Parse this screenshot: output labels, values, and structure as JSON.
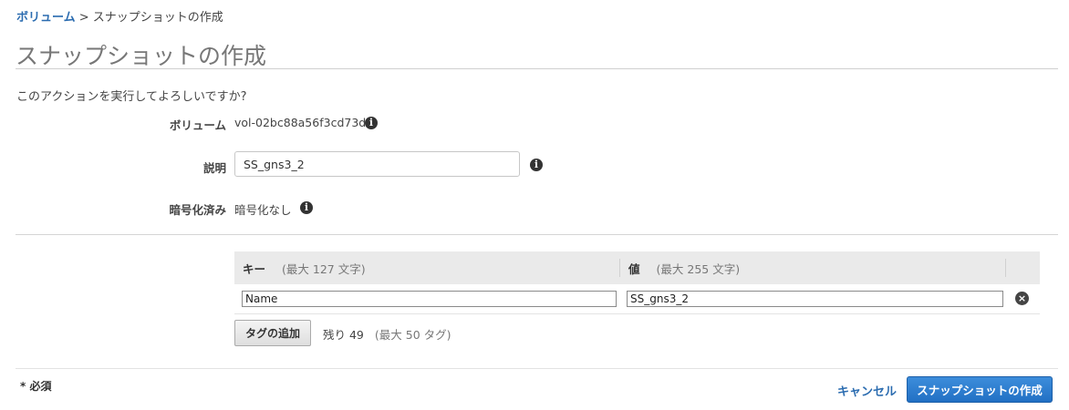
{
  "breadcrumb": {
    "link": "ボリューム",
    "separator": " > ",
    "current": "スナップショットの作成"
  },
  "page_title": "スナップショットの作成",
  "confirm_text": "このアクションを実行してよろしいですか?",
  "fields": {
    "volume": {
      "label": "ボリューム",
      "value": "vol-02bc88a56f3cd73d6",
      "icon": "info-icon"
    },
    "description": {
      "label": "説明",
      "value": "SS_gns3_2",
      "icon": "info-icon"
    },
    "encryption": {
      "label": "暗号化済み",
      "value": "暗号化なし",
      "icon": "info-icon"
    }
  },
  "tags": {
    "header": {
      "key_label": "キー",
      "key_hint": "(最大 127 文字)",
      "value_label": "値",
      "value_hint": "(最大 255 文字)"
    },
    "rows": [
      {
        "key": "Name",
        "value": "SS_gns3_2",
        "remove_icon": "remove-circle-icon"
      }
    ],
    "add_button": "タグの追加",
    "remaining": "残り 49",
    "max_hint": "(最大 50 タグ)"
  },
  "footer": {
    "required": "* 必須",
    "cancel": "キャンセル",
    "submit": "スナップショットの作成"
  },
  "colors": {
    "link": "#2b6cb0",
    "primary_button": "#2270c4",
    "table_header": "#eaeaea"
  }
}
